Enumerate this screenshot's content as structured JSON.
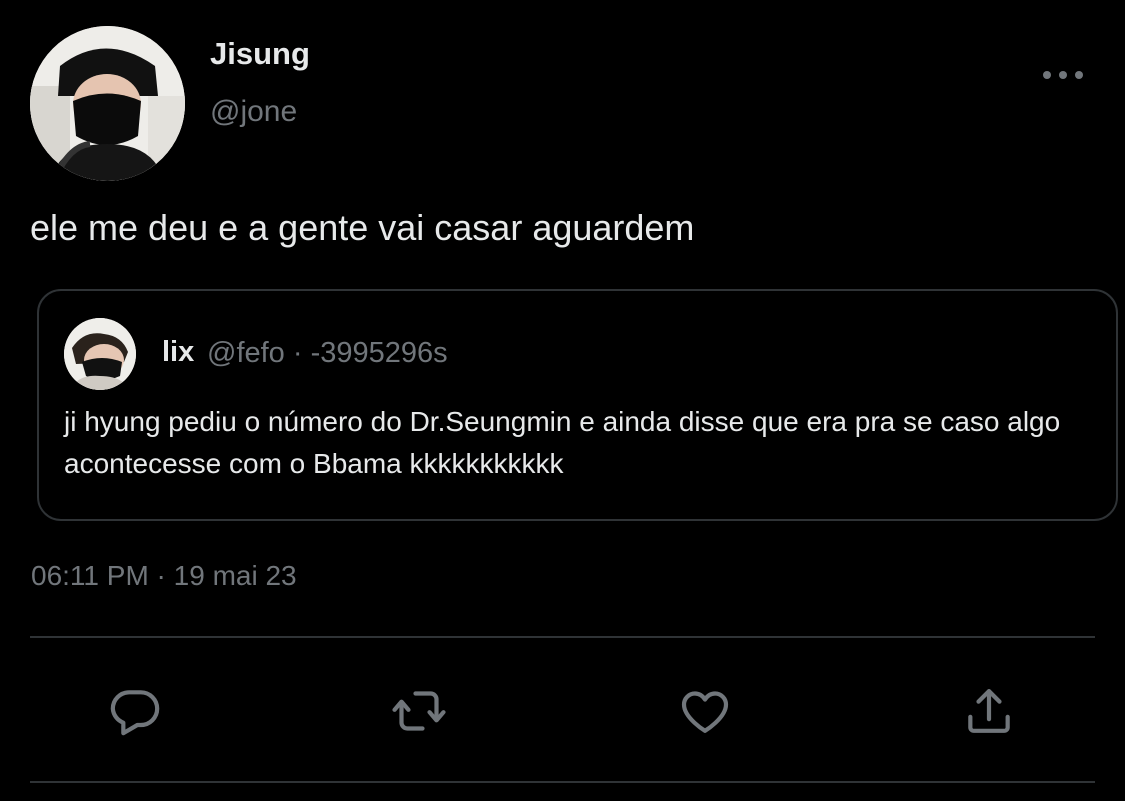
{
  "author": {
    "name": "Jisung",
    "handle": "@jone"
  },
  "tweet": {
    "text": "ele me deu e a gente vai casar aguardem",
    "timestamp": "06:11 PM · 19 mai 23"
  },
  "quote": {
    "name": "lix",
    "meta": "@fefo · -3995296s",
    "text": "ji hyung pediu o número do Dr.Seungmin e ainda disse que era pra se caso algo acontecesse com o Bbama kkkkkkkkkkk"
  },
  "icons": {
    "more": "more-horizontal-icon",
    "reply": "reply-bubble-icon",
    "retweet": "retweet-icon",
    "like": "heart-icon",
    "share": "share-upload-icon"
  },
  "colors": {
    "background": "#000000",
    "primary_text": "#e7e9ea",
    "secondary_text": "#71767b",
    "border": "#2f3336"
  }
}
